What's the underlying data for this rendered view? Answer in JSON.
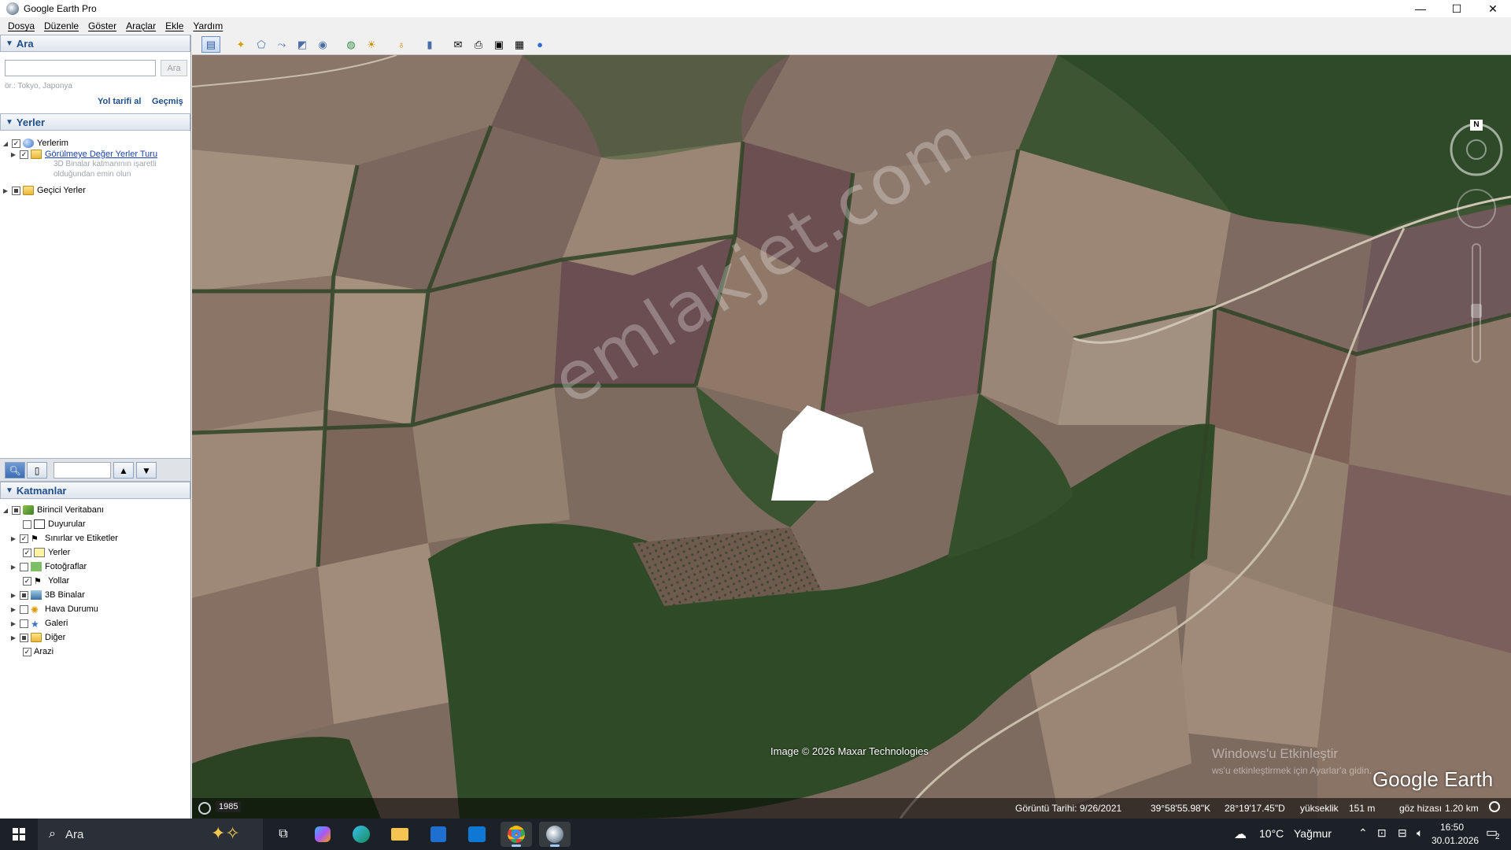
{
  "window": {
    "title": "Google Earth Pro",
    "controls": [
      "—",
      "☐",
      "✕"
    ]
  },
  "menu": [
    "Dosya",
    "Düzenle",
    "Göster",
    "Araçlar",
    "Ekle",
    "Yardım"
  ],
  "search": {
    "header": "Ara",
    "button": "Ara",
    "placeholder": "",
    "hint": "ör.: Tokyo, Japonya",
    "link_directions": "Yol tarifi al",
    "link_history": "Geçmiş"
  },
  "places": {
    "header": "Yerler",
    "items": [
      {
        "label": "Yerlerim",
        "checked": true
      },
      {
        "label": "Görülmeye Değer Yerler Turu",
        "checked": true
      },
      {
        "label": "Geçici Yerler",
        "checked": "partial"
      }
    ],
    "note_line1": "3D Binalar katmanının işaretli",
    "note_line2": "olduğundan emin olun"
  },
  "layers": {
    "header": "Katmanlar",
    "root": "Birincil Veritabanı",
    "items": [
      {
        "label": "Duyurular",
        "checked": false
      },
      {
        "label": "Sınırlar ve Etiketler",
        "checked": true
      },
      {
        "label": "Yerler",
        "checked": true
      },
      {
        "label": "Fotoğraflar",
        "checked": false
      },
      {
        "label": "Yollar",
        "checked": true
      },
      {
        "label": "3B Binalar",
        "checked": "partial"
      },
      {
        "label": "Hava Durumu",
        "checked": false
      },
      {
        "label": "Galeri",
        "checked": false
      },
      {
        "label": "Diğer",
        "checked": "partial"
      },
      {
        "label": "Arazi",
        "checked": true
      }
    ]
  },
  "map": {
    "watermark": "emlakjet.com",
    "attribution": "Image © 2026 Maxar Technologies",
    "logo": "Google Earth",
    "compass_letter": "N",
    "win_activation_title": "Windows'u Etkinleştir",
    "win_activation_sub": "ws'u etkinleştirmek için Ayarlar'a gidin."
  },
  "status": {
    "year": "1985",
    "image_date": "Görüntü Tarihi: 9/26/2021",
    "lat": "39°58'55.98\"K",
    "lon": "28°19'17.45\"D",
    "elev_label": "yükseklik",
    "elev_value": "151 m",
    "eye_label": "göz hizası",
    "eye_value": "1.20 km"
  },
  "taskbar": {
    "search": "Ara",
    "weather_temp": "10°C",
    "weather_text": "Yağmur",
    "time": "16:50",
    "date": "30.01.2026",
    "notif_count": "2"
  },
  "colors": {
    "panel_blue": "#1f4e8a",
    "taskbar": "#1c2127",
    "forest": "#2f4a26",
    "field": "#8b7a6b"
  }
}
